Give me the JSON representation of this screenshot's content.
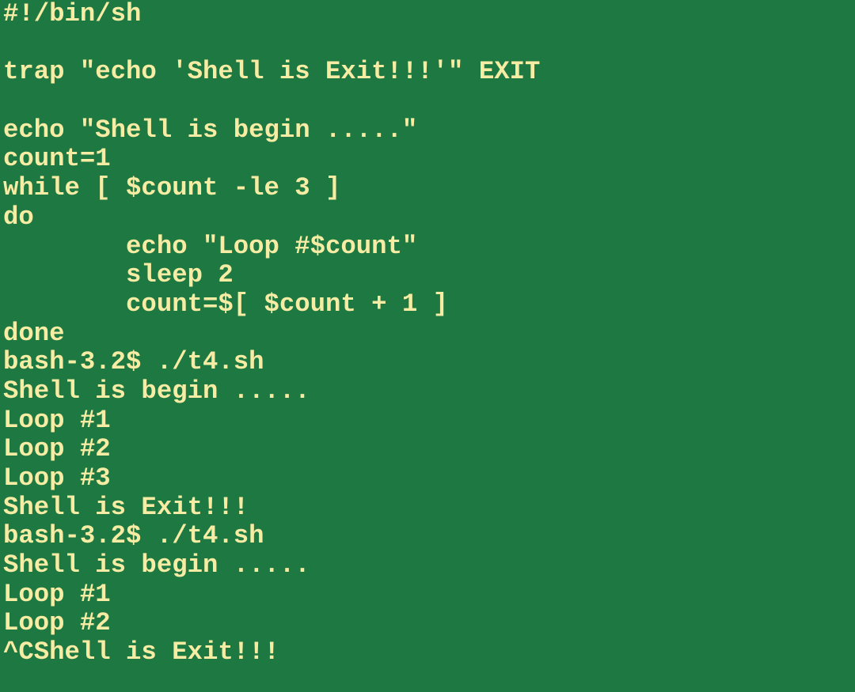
{
  "terminal": {
    "background": "#1e7842",
    "foreground": "#f6eca4",
    "lines": [
      "#!/bin/sh",
      "",
      "trap \"echo 'Shell is Exit!!!'\" EXIT",
      "",
      "echo \"Shell is begin .....\"",
      "count=1",
      "while [ $count -le 3 ]",
      "do",
      "        echo \"Loop #$count\"",
      "        sleep 2",
      "        count=$[ $count + 1 ]",
      "done",
      "bash-3.2$ ./t4.sh",
      "Shell is begin .....",
      "Loop #1",
      "Loop #2",
      "Loop #3",
      "Shell is Exit!!!",
      "bash-3.2$ ./t4.sh",
      "Shell is begin .....",
      "Loop #1",
      "Loop #2",
      "^CShell is Exit!!!"
    ]
  }
}
